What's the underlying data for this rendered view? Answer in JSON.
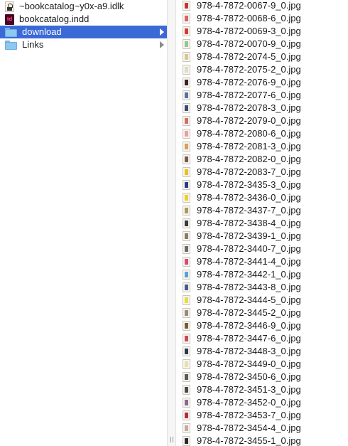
{
  "left_column": {
    "items": [
      {
        "label": "~bookcatalog~y0x-a9.idlk",
        "icon": "lock-file-icon",
        "selected": false,
        "has_arrow": false
      },
      {
        "label": "bookcatalog.indd",
        "icon": "indesign-file-icon",
        "icon_text": "Id",
        "selected": false,
        "has_arrow": false
      },
      {
        "label": "download",
        "icon": "folder-icon",
        "selected": true,
        "has_arrow": true
      },
      {
        "label": "Links",
        "icon": "folder-icon",
        "selected": false,
        "has_arrow": true
      }
    ]
  },
  "right_column": {
    "files": [
      {
        "label": "978-4-7872-0067-9_0.jpg",
        "thumb_color": "#c8323a"
      },
      {
        "label": "978-4-7872-0068-6_0.jpg",
        "thumb_color": "#d8646a"
      },
      {
        "label": "978-4-7872-0069-3_0.jpg",
        "thumb_color": "#d83a32"
      },
      {
        "label": "978-4-7872-0070-9_0.jpg",
        "thumb_color": "#9ac48a"
      },
      {
        "label": "978-4-7872-2074-5_0.jpg",
        "thumb_color": "#d8c890"
      },
      {
        "label": "978-4-7872-2075-2_0.jpg",
        "thumb_color": "#e0dcc8"
      },
      {
        "label": "978-4-7872-2076-9_0.jpg",
        "thumb_color": "#3a2228"
      },
      {
        "label": "978-4-7872-2077-6_0.jpg",
        "thumb_color": "#5a6ea8"
      },
      {
        "label": "978-4-7872-2078-3_0.jpg",
        "thumb_color": "#3a4a7a"
      },
      {
        "label": "978-4-7872-2079-0_0.jpg",
        "thumb_color": "#d86a6a"
      },
      {
        "label": "978-4-7872-2080-6_0.jpg",
        "thumb_color": "#e8a0a0"
      },
      {
        "label": "978-4-7872-2081-3_0.jpg",
        "thumb_color": "#d8a060"
      },
      {
        "label": "978-4-7872-2082-0_0.jpg",
        "thumb_color": "#7a5a4a"
      },
      {
        "label": "978-4-7872-2083-7_0.jpg",
        "thumb_color": "#e8c020"
      },
      {
        "label": "978-4-7872-3435-3_0.jpg",
        "thumb_color": "#2a3a8a"
      },
      {
        "label": "978-4-7872-3436-0_0.jpg",
        "thumb_color": "#f0d020"
      },
      {
        "label": "978-4-7872-3437-7_0.jpg",
        "thumb_color": "#a89a60"
      },
      {
        "label": "978-4-7872-3438-4_0.jpg",
        "thumb_color": "#3a3a3a"
      },
      {
        "label": "978-4-7872-3439-1_0.jpg",
        "thumb_color": "#8a7a6a"
      },
      {
        "label": "978-4-7872-3440-7_0.jpg",
        "thumb_color": "#6a6a6a"
      },
      {
        "label": "978-4-7872-3441-4_0.jpg",
        "thumb_color": "#d84a7a"
      },
      {
        "label": "978-4-7872-3442-1_0.jpg",
        "thumb_color": "#5aa0d8"
      },
      {
        "label": "978-4-7872-3443-8_0.jpg",
        "thumb_color": "#4a5a8a"
      },
      {
        "label": "978-4-7872-3444-5_0.jpg",
        "thumb_color": "#e0e040"
      },
      {
        "label": "978-4-7872-3445-2_0.jpg",
        "thumb_color": "#9a8a7a"
      },
      {
        "label": "978-4-7872-3446-9_0.jpg",
        "thumb_color": "#7a5a3a"
      },
      {
        "label": "978-4-7872-3447-6_0.jpg",
        "thumb_color": "#c84a5a"
      },
      {
        "label": "978-4-7872-3448-3_0.jpg",
        "thumb_color": "#2a3a4a"
      },
      {
        "label": "978-4-7872-3449-0_0.jpg",
        "thumb_color": "#e8e0b0"
      },
      {
        "label": "978-4-7872-3450-6_0.jpg",
        "thumb_color": "#5a5a5a"
      },
      {
        "label": "978-4-7872-3451-3_0.jpg",
        "thumb_color": "#4a4a4a"
      },
      {
        "label": "978-4-7872-3452-0_0.jpg",
        "thumb_color": "#8a6a8a"
      },
      {
        "label": "978-4-7872-3453-7_0.jpg",
        "thumb_color": "#b82a3a"
      },
      {
        "label": "978-4-7872-3454-4_0.jpg",
        "thumb_color": "#c8a8a8"
      },
      {
        "label": "978-4-7872-3455-1_0.jpg",
        "thumb_color": "#2a2a2a"
      }
    ]
  }
}
